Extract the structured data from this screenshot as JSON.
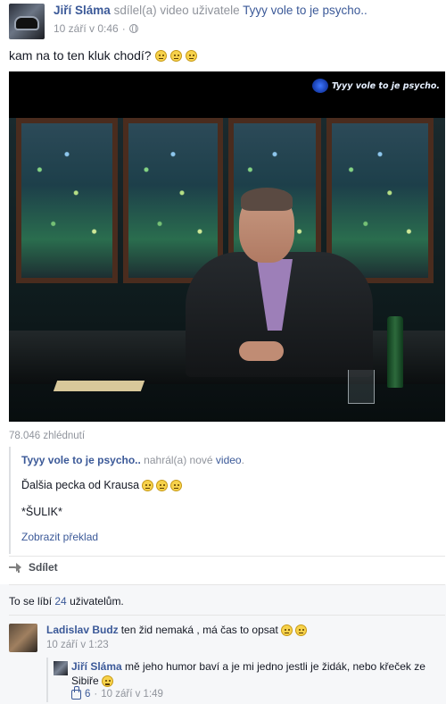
{
  "post": {
    "author": "Jiří Sláma",
    "verb": "sdílel(a) video uživatele",
    "source": "Tyyy vole to je psycho..",
    "time": "10 září v 0:46",
    "sep": "·",
    "text": "kam na to ten kluk chodí?",
    "emoji_count": 3
  },
  "video": {
    "watermark": "Tyyy vole to je psycho.",
    "views": "78.046 zhlédnutí"
  },
  "shared": {
    "page": "Tyyy vole to je psycho..",
    "verb": "nahrál(a) nové",
    "video_link": "video",
    "period": ".",
    "text": "Ďalšia pecka od Krausa",
    "emoji_count": 3,
    "text2": "*ŠULIK*",
    "translate": "Zobrazit překlad"
  },
  "actions": {
    "share": "Sdílet"
  },
  "likes": {
    "prefix": "To se líbí",
    "count": "24",
    "suffix": "uživatelům."
  },
  "comments": [
    {
      "author": "Ladislav Budz",
      "text": "ten žid nemaká , má čas to opsat",
      "time": "10 září v 1:23",
      "reply": {
        "author": "Jiří Sláma",
        "text": "mě jeho humor baví a je mi jedno jestli je židák, nebo křeček ze Sibiře",
        "likes": "6",
        "sep": "·",
        "time": "10 září v 1:49"
      }
    }
  ],
  "colors": {
    "link": "#3b5998",
    "meta": "#90949c",
    "text": "#141823"
  },
  "icons": [
    "globe-icon",
    "share-icon",
    "like-thumb-icon",
    "smiley-icon"
  ]
}
